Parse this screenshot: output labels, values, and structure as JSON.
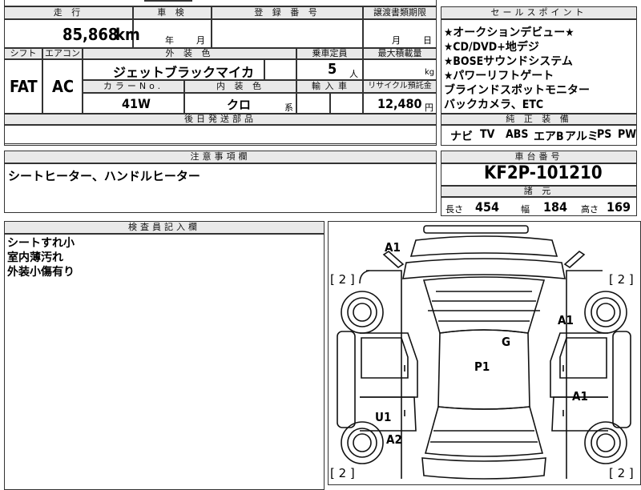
{
  "header": {
    "mileage_label": "走 行",
    "inspection_label": "車 検",
    "reg_no_label": "登 録 番 号",
    "transfer_docs_label": "譲渡書類期限",
    "sales_points_label": "セールスポイント"
  },
  "vehicle": {
    "mileage": "85,868",
    "mileage_unit": "km",
    "inspection_year_unit": "年",
    "inspection_month_unit": "月",
    "transfer_month_unit": "月",
    "transfer_day_unit": "日",
    "shift_label": "シフト",
    "ac_label": "エアコン",
    "shift": "FAT",
    "ac": "AC",
    "exterior_color_label": "外 装 色",
    "exterior_color": "ジェットブラックマイカ",
    "capacity_label": "乗車定員",
    "capacity": "5",
    "capacity_unit": "人",
    "max_load_label": "最大積載量",
    "max_load_unit": "kg",
    "color_no_label": "カラーNo.",
    "color_no": "41W",
    "interior_color_label": "内 装 色",
    "interior_color": "クロ",
    "interior_suffix": "系",
    "import_label": "輸 入 車",
    "recycle_label": "リサイクル預託金",
    "recycle_fee": "12,480",
    "recycle_unit": "円",
    "later_parts_label": "後日発送部品"
  },
  "sales_points": [
    "★オークションデビュー★",
    "★CD/DVD+地デジ",
    "★BOSEサウンドシステム",
    "★パワーリフトゲート",
    "ブラインドスポットモニター",
    "バックカメラ、ETC"
  ],
  "equipment": {
    "label": "純 正 装 備",
    "items": [
      "ナビ",
      "TV",
      "ABS",
      "エアB",
      "アルミ",
      "PS",
      "PW"
    ]
  },
  "notes": {
    "label": "注意事項欄",
    "text": "シートヒーター、ハンドルヒーター"
  },
  "chassis": {
    "label": "車台番号",
    "number": "KF2P-101210",
    "specs_label": "諸 元",
    "length_label": "長さ",
    "length": "454",
    "width_label": "幅",
    "width": "184",
    "height_label": "高さ",
    "height": "169"
  },
  "inspector": {
    "label": "検査員記入欄",
    "lines": [
      "シートすれ小",
      "室内薄汚れ",
      "外装小傷有り"
    ]
  },
  "diagram": {
    "marks": [
      "A1",
      "A1",
      "G",
      "P1",
      "A1",
      "U1",
      "A2"
    ],
    "tire_marks": [
      "[ 2 ]",
      "[ 2 ]",
      "[ 2 ]",
      "[ 2 ]"
    ]
  }
}
